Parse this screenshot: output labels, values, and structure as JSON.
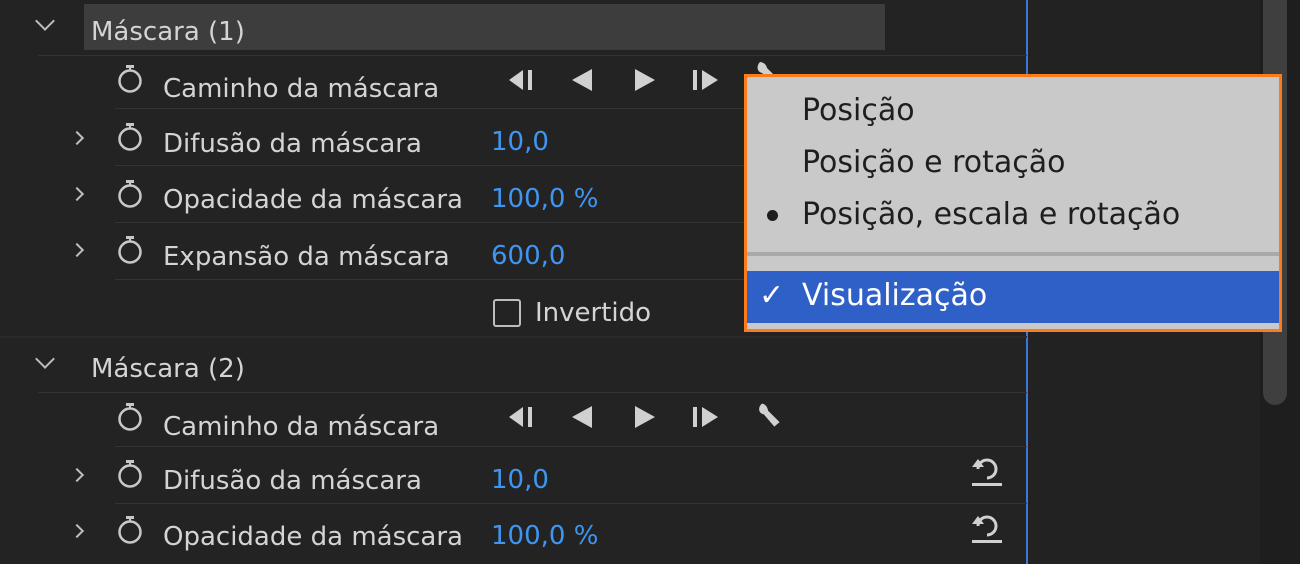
{
  "masks": [
    {
      "title": "Máscara (1)",
      "path_label": "Caminho da máscara",
      "props": [
        {
          "label": "Difusão da máscara",
          "value": "10,0"
        },
        {
          "label": "Opacidade da máscara",
          "value": "100,0 %"
        },
        {
          "label": "Expansão da máscara",
          "value": "600,0"
        }
      ],
      "inverted_label": "Invertido"
    },
    {
      "title": "Máscara (2)",
      "path_label": "Caminho da máscara",
      "props": [
        {
          "label": "Difusão da máscara",
          "value": "10,0"
        },
        {
          "label": "Opacidade da máscara",
          "value": "100,0 %"
        }
      ]
    }
  ],
  "menu": {
    "items": [
      {
        "label": "Posição"
      },
      {
        "label": "Posição e rotação"
      },
      {
        "label": "Posição, escala e rotação",
        "marker": "•"
      },
      {
        "label": "Visualização",
        "marker": "✓"
      }
    ]
  },
  "colors": {
    "value_blue": "#3f96f2",
    "menu_border_orange": "#ff7a1a",
    "menu_selected_blue": "#2e60c7",
    "playhead_blue": "#3a78d8"
  }
}
